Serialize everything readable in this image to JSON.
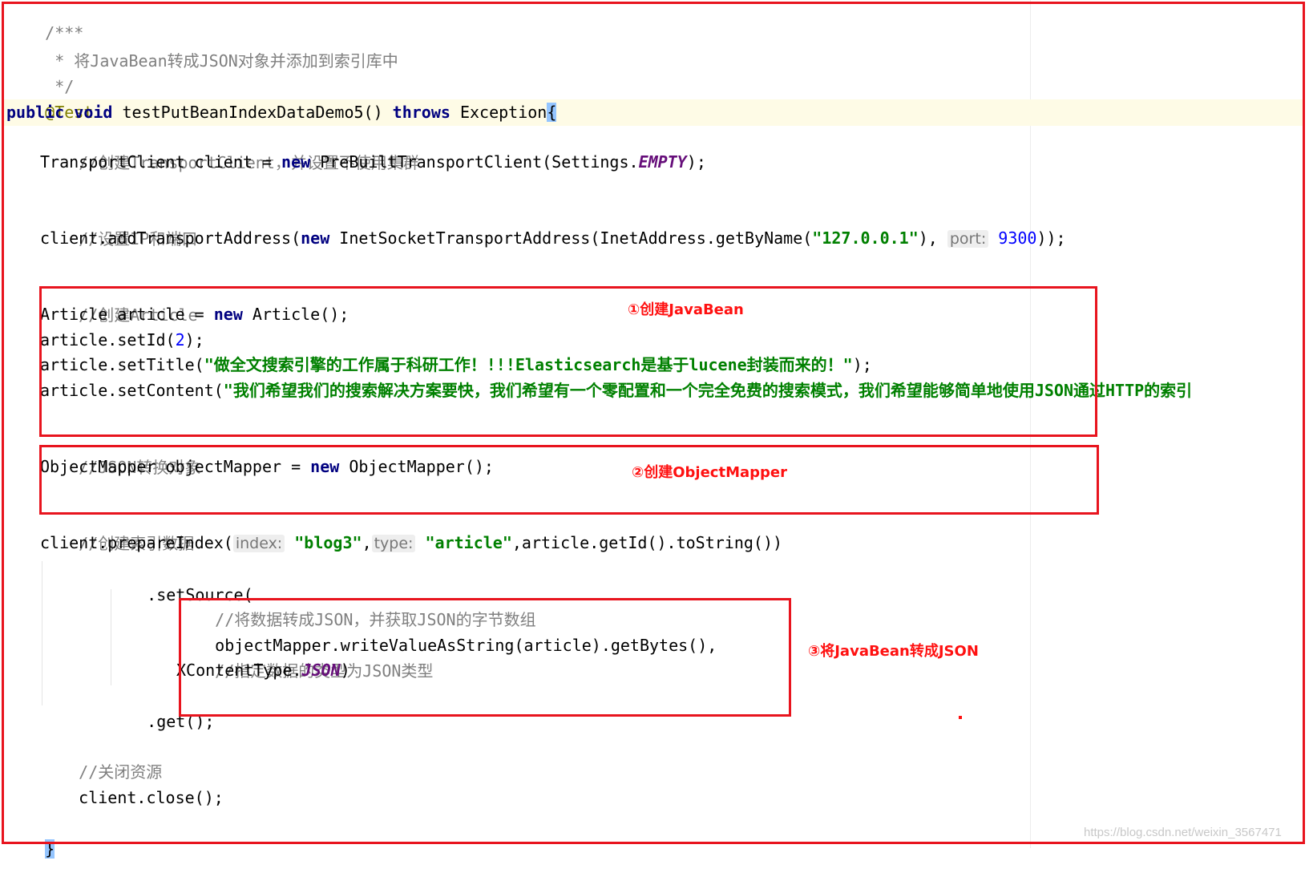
{
  "code": {
    "l0_doc_open": "/***",
    "l1_doc": " * 将JavaBean转成JSON对象并添加到索引库中",
    "l2_doc_close": " */",
    "l3_annotation": "@Test",
    "l4_kw_public": "public",
    "l4_kw_void": "void",
    "l4_method": " testPutBeanIndexDataDemo5() ",
    "l4_kw_throws": "throws",
    "l4_exception": " Exception",
    "l4_brace": "{",
    "l5_comment": "//创建TransportClient，并设置不使用集群",
    "l6_a": "TransportClient client = ",
    "l6_new": "new",
    "l6_b": " PreBuiltTransportClient(Settings.",
    "l6_empty": "EMPTY",
    "l6_c": ");",
    "l7_comment": "//设置IP和端口",
    "l8_a": "client.addTransportAddress(",
    "l8_new": "new",
    "l8_b": " InetSocketTransportAddress(InetAddress.getByName(",
    "l8_str": "\"127.0.0.1\"",
    "l8_c": "), ",
    "l8_hint": "port:",
    "l8_num": "9300",
    "l8_d": "));",
    "l9_comment": "//创建Article",
    "l10_a": "Article article = ",
    "l10_new": "new",
    "l10_b": " Article();",
    "l11_a": "article.setId(",
    "l11_num": "2",
    "l11_b": ");",
    "l12_a": "article.setTitle(",
    "l12_str": "\"做全文搜索引擎的工作属于科研工作！!!!Elasticsearch是基于lucene封装而来的！\"",
    "l12_b": ");",
    "l13_a": "article.setContent(",
    "l13_str": "\"我们希望我们的搜索解决方案要快，我们希望有一个零配置和一个完全免费的搜索模式，我们希望能够简单地使用JSON通过HTTP的索引",
    "l14_comment": "//JSON转换对象",
    "l15_a": "ObjectMapper objectMapper = ",
    "l15_new": "new",
    "l15_b": " ObjectMapper();",
    "l16_comment": "//创建索引数据",
    "l17_a": "client.prepareIndex(",
    "l17_hint1": "index:",
    "l17_str1": "\"blog3\"",
    "l17_b": ",",
    "l17_hint2": "type:",
    "l17_str2": "\"article\"",
    "l17_c": ",article.getId().toString())",
    "l18": ".setSource(",
    "l19_comment": "//将数据转成JSON，并获取JSON的字节数组",
    "l20": "objectMapper.writeValueAsString(article).getBytes(),",
    "l21_comment": "//指定数据的类型为JSON类型",
    "l22_a": "XContentType.",
    "l22_json": "JSON",
    "l22_b": ")",
    "l23": ".get();",
    "l24_comment": "//关闭资源",
    "l25": "client.close();",
    "l26_brace": "}"
  },
  "annotations": {
    "step1": "①创建JavaBean",
    "step2": "②创建ObjectMapper",
    "step3": "③将JavaBean转成JSON"
  },
  "watermark": "https://blog.csdn.net/weixin_3567471",
  "colors": {
    "annotation_red": "#e8141e",
    "keyword": "#000080",
    "string": "#008000",
    "comment": "#808080",
    "number": "#0000ff",
    "current_line": "#fefbe6"
  }
}
